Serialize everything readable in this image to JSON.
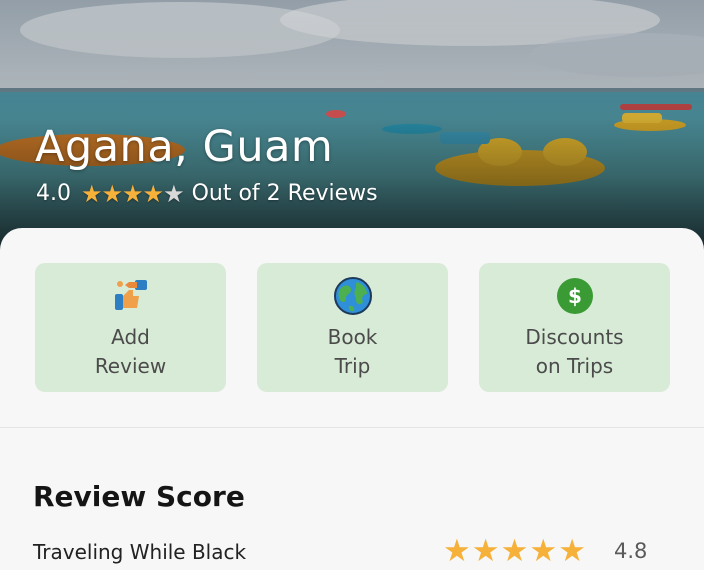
{
  "hero": {
    "title": "Agana, Guam",
    "rating_value": "4.0",
    "rating_fraction": 0.8,
    "reviews_text": "Out of 2 Reviews",
    "stars": [
      "★",
      "★",
      "★",
      "★",
      "★"
    ]
  },
  "actions": [
    {
      "label": "Add\nReview",
      "icon": "thumbs-review-icon"
    },
    {
      "label": "Book\nTrip",
      "icon": "globe-icon"
    },
    {
      "label": "Discounts\non Trips",
      "icon": "dollar-icon"
    }
  ],
  "review_score": {
    "title": "Review Score",
    "rows": [
      {
        "name": "Traveling While Black",
        "value": "4.8",
        "stars": [
          "★",
          "★",
          "★",
          "★",
          "★"
        ]
      }
    ]
  },
  "colors": {
    "action_bg": "#d8ebd7",
    "star": "#f6b13a",
    "dollar": "#3a9b35"
  }
}
